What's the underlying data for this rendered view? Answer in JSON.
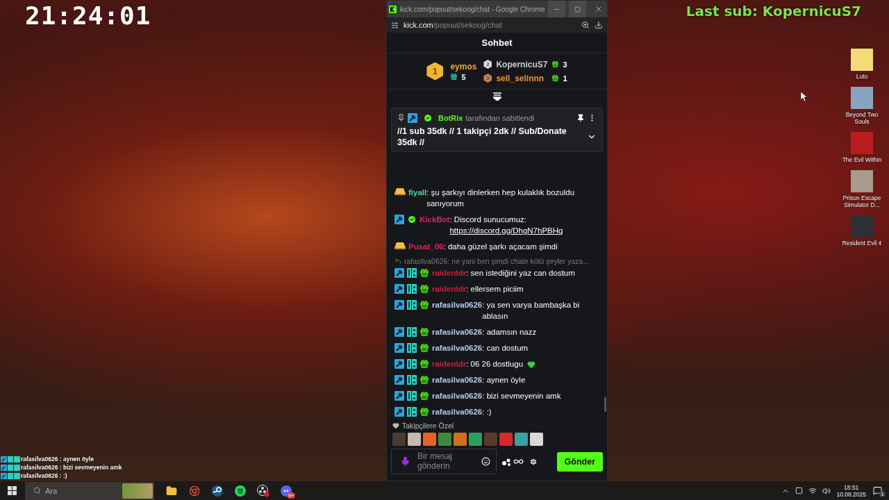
{
  "stream_overlay": {
    "clock": "21:24:01",
    "last_sub": "Last sub: KopernicuS7"
  },
  "browser": {
    "title": "kick.com/popout/sekoog/chat - Google Chrome",
    "url_domain": "kick.com",
    "url_path": "/popout/sekoog/chat"
  },
  "chat": {
    "title": "Sohbet",
    "leaderboard": [
      {
        "rank": "1",
        "name": "eymos",
        "count": "5",
        "color": "#f0a531"
      },
      {
        "rank": "2",
        "name": "KopernicuS7",
        "count": "3",
        "color": "#c9ccd1"
      },
      {
        "rank": "3",
        "name": "sell_selinnn",
        "count": "1",
        "color": "#e8923a"
      }
    ],
    "pinned": {
      "pinner": "BotRix",
      "suffix": "tarafından sabitlendi",
      "text": "//1 sub 35dk // 1 takipçi 2dk // Sub/Donate 35dk //"
    },
    "messages": [
      {
        "kind": "message",
        "gold_bar": true,
        "moderator": false,
        "verified": false,
        "og": false,
        "subscriber": false,
        "heart_emote": false,
        "user": "fiyall",
        "color": "#53d6a0",
        "text": ": şu şarkıyı dinlerken hep kulaklık bozuldu sanıyorum"
      },
      {
        "kind": "message",
        "gold_bar": false,
        "moderator": true,
        "verified": true,
        "og": false,
        "subscriber": false,
        "heart_emote": false,
        "user": "KickBot",
        "color": "#e0245e",
        "text": ": Discord sunucumuz:",
        "link": "https://discord.gg/DhgN7hPBHq"
      },
      {
        "kind": "message",
        "gold_bar": true,
        "moderator": false,
        "verified": false,
        "og": false,
        "subscriber": false,
        "heart_emote": false,
        "user": "Pusat_06",
        "color": "#e0245e",
        "text": ": daha güzel şarkı açacam şimdi"
      },
      {
        "kind": "reply",
        "text": "rafasilva0626: ne yani ben şimdi chate kötü şeyler yaza..."
      },
      {
        "kind": "message",
        "gold_bar": false,
        "moderator": true,
        "verified": false,
        "og": true,
        "subscriber": true,
        "heart_emote": false,
        "user": "raidenldr",
        "color": "#c8203f",
        "text": ": sen istediğini yaz can dostum"
      },
      {
        "kind": "message",
        "gold_bar": false,
        "moderator": true,
        "verified": false,
        "og": true,
        "subscriber": true,
        "heart_emote": false,
        "user": "raidenldr",
        "color": "#c8203f",
        "text": ": ellersem piciim"
      },
      {
        "kind": "message",
        "gold_bar": false,
        "moderator": true,
        "verified": false,
        "og": true,
        "subscriber": true,
        "heart_emote": false,
        "user": "rafasilva0626",
        "color": "#b9c9f2",
        "text": ": ya sen varya bambaşka bi ablasın"
      },
      {
        "kind": "message",
        "gold_bar": false,
        "moderator": true,
        "verified": false,
        "og": true,
        "subscriber": true,
        "heart_emote": false,
        "user": "rafasilva0626",
        "color": "#b9c9f2",
        "text": ": adamsın nazz"
      },
      {
        "kind": "message",
        "gold_bar": false,
        "moderator": true,
        "verified": false,
        "og": true,
        "subscriber": true,
        "heart_emote": false,
        "user": "rafasilva0626",
        "color": "#b9c9f2",
        "text": ": can dostum"
      },
      {
        "kind": "message",
        "gold_bar": false,
        "moderator": true,
        "verified": false,
        "og": true,
        "subscriber": true,
        "heart_emote": true,
        "user": "raidenldr",
        "color": "#c8203f",
        "text": ": 06 26 dostlugu"
      },
      {
        "kind": "message",
        "gold_bar": false,
        "moderator": true,
        "verified": false,
        "og": true,
        "subscriber": true,
        "heart_emote": false,
        "user": "rafasilva0626",
        "color": "#b9c9f2",
        "text": ": aynen öyle"
      },
      {
        "kind": "message",
        "gold_bar": false,
        "moderator": true,
        "verified": false,
        "og": true,
        "subscriber": true,
        "heart_emote": false,
        "user": "rafasilva0626",
        "color": "#b9c9f2",
        "text": ": bizi sevmeyenin amk"
      },
      {
        "kind": "message",
        "gold_bar": false,
        "moderator": true,
        "verified": false,
        "og": true,
        "subscriber": true,
        "heart_emote": false,
        "user": "rafasilva0626",
        "color": "#b9c9f2",
        "text": ": :)"
      }
    ],
    "emote_section": {
      "title": "Takipçilere Özel"
    },
    "emotes": [
      {
        "color": "#4a3a30"
      },
      {
        "color": "#c9b8b0"
      },
      {
        "color": "#e8621f"
      },
      {
        "color": "#3f8a3a"
      },
      {
        "color": "#d0701c"
      },
      {
        "color": "#28a060"
      },
      {
        "color": "#5a3a2a"
      },
      {
        "color": "#d8282a"
      },
      {
        "color": "#3aa0a0"
      },
      {
        "color": "#d8d8d8"
      }
    ],
    "input": {
      "placeholder": "Bir mesaj gönderin"
    },
    "send_button": "Gönder"
  },
  "desktop_icons": [
    {
      "label": "Luto",
      "color": "#f2dc78"
    },
    {
      "label": "Beyond Two Souls",
      "color": "#8aa4c0"
    },
    {
      "label": "The Evil Within",
      "color": "#b81e1e"
    },
    {
      "label": "Prison Escape Simulator D...",
      "color": "#a89c8c"
    },
    {
      "label": "Resident Evil 4",
      "color": "#2c3034"
    }
  ],
  "overlay_chat": [
    {
      "user": "rafasilva0626",
      "text": " : aynen öyle"
    },
    {
      "user": "rafasilva0626",
      "text": " : bizi sevmeyenin amk"
    },
    {
      "user": "rafasilva0626",
      "text": " : :)"
    }
  ],
  "taskbar": {
    "search_placeholder": "Ara",
    "apps": [
      {
        "kind": "explorer"
      },
      {
        "kind": "chrome"
      },
      {
        "kind": "steam"
      },
      {
        "kind": "spotify"
      },
      {
        "kind": "obs"
      },
      {
        "kind": "discord",
        "badge": "9+"
      }
    ],
    "time": "18:51",
    "date": "10.08.2025",
    "notifications": "1"
  }
}
